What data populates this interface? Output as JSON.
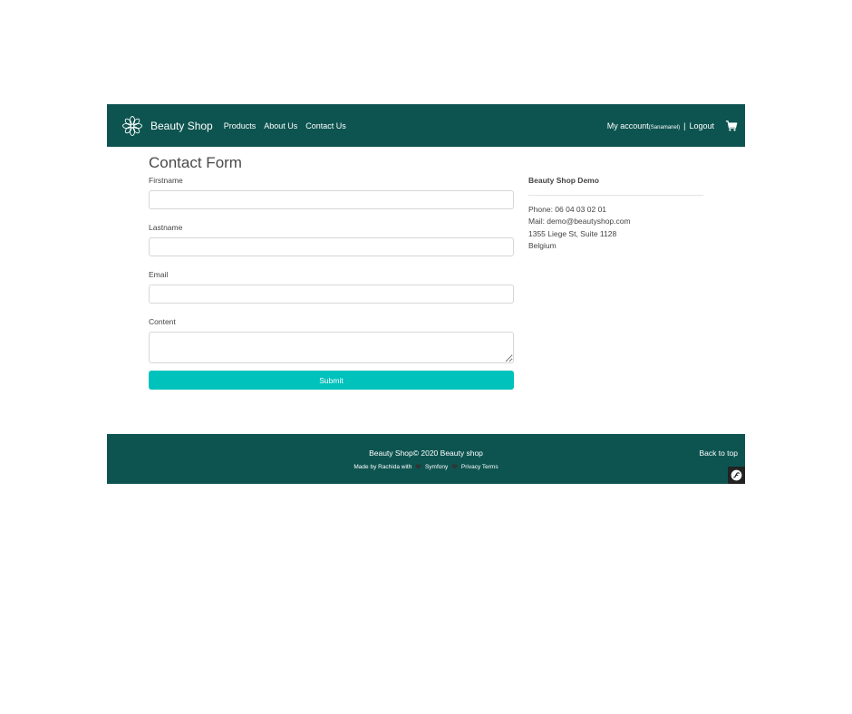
{
  "header": {
    "brand": "Beauty Shop",
    "nav": [
      "Products",
      "About Us",
      "Contact Us"
    ],
    "account_label": "My account",
    "account_user": "(Sanamanel)",
    "separator": "|",
    "logout_label": "Logout"
  },
  "contact": {
    "title": "Contact Form",
    "fields": {
      "firstname": {
        "label": "Firstname",
        "value": ""
      },
      "lastname": {
        "label": "Lastname",
        "value": ""
      },
      "email": {
        "label": "Email",
        "value": ""
      },
      "content": {
        "label": "Content",
        "value": ""
      }
    },
    "submit_label": "Submit"
  },
  "info": {
    "title": "Beauty Shop Demo",
    "phone": "Phone: 06 04 03 02 01",
    "mail": "Mail: demo@beautyshop.com",
    "address": "1355 Liege St, Suite 1128",
    "country": "Belgium"
  },
  "footer": {
    "copyright": "Beauty Shop© 2020 Beauty shop",
    "made_by": "Made by Rachida with",
    "symfony": "Symfony",
    "privacy": "Privacy",
    "terms": "Terms",
    "back_to_top": "Back to top"
  },
  "colors": {
    "brand_dark": "#0d5450",
    "accent": "#00c2bd"
  },
  "icons": [
    "flower-logo-icon",
    "cart-icon",
    "heart-icon",
    "symfony-icon"
  ]
}
